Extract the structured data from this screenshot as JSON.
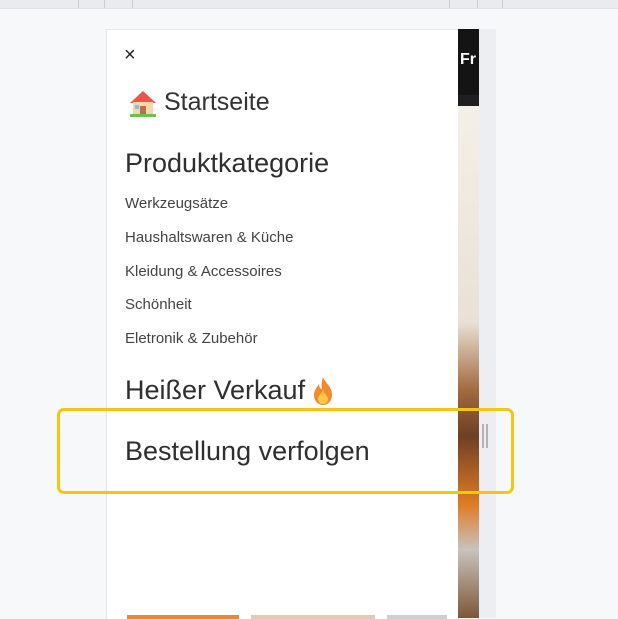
{
  "drawer": {
    "close_label": "×",
    "home": {
      "icon": "house-emoji-icon",
      "label": "Startseite"
    },
    "category_heading": "Produktkategorie",
    "categories": [
      "Werkzeugsätze",
      "Haushaltswaren & Küche",
      "Kleidung & Accessoires",
      "Schönheit",
      "Eletronik & Zubehör"
    ],
    "hot_sale": {
      "label": "Heißer Verkauf",
      "icon": "fire-emoji-icon"
    },
    "track_order": "Bestellung verfolgen"
  },
  "background_page": {
    "header_text_fragment": "Fr"
  },
  "colors": {
    "highlight": "#f3c711",
    "drawer_bg": "#ffffff",
    "heading_text": "#2f2f2f"
  }
}
